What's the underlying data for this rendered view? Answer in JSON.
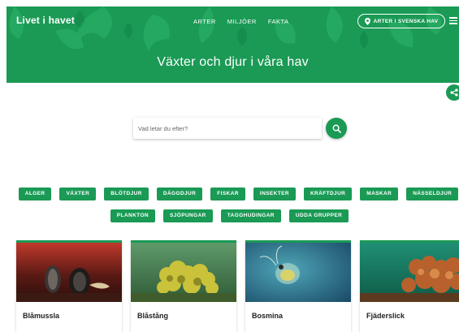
{
  "header": {
    "brand": "Livet i havet",
    "nav": [
      "ARTER",
      "MILJÖER",
      "FAKTA"
    ],
    "region_button": "ARTER I SVENSKA HAV",
    "hero_title": "Växter och djur i våra hav"
  },
  "search": {
    "placeholder": "Vad letar du efter?"
  },
  "categories_row1": [
    "ALGER",
    "VÄXTER",
    "BLÖTDJUR",
    "DÄGGDJUR",
    "FISKAR",
    "INSEKTER",
    "KRÄFTDJUR",
    "MASKAR",
    "NÄSSELDJUR"
  ],
  "categories_row2": [
    "PLANKTON",
    "SJÖPUNGAR",
    "TAGGHUDINGAR",
    "UDDA GRUPPER"
  ],
  "cards": [
    {
      "title": "Blåmussla"
    },
    {
      "title": "Blåstång"
    },
    {
      "title": "Bosmina"
    },
    {
      "title": "Fjäderslick"
    }
  ],
  "colors": {
    "brand_green": "#1a9a55"
  },
  "icons": [
    "location-pin-icon",
    "menu-icon",
    "share-icon",
    "search-icon"
  ]
}
